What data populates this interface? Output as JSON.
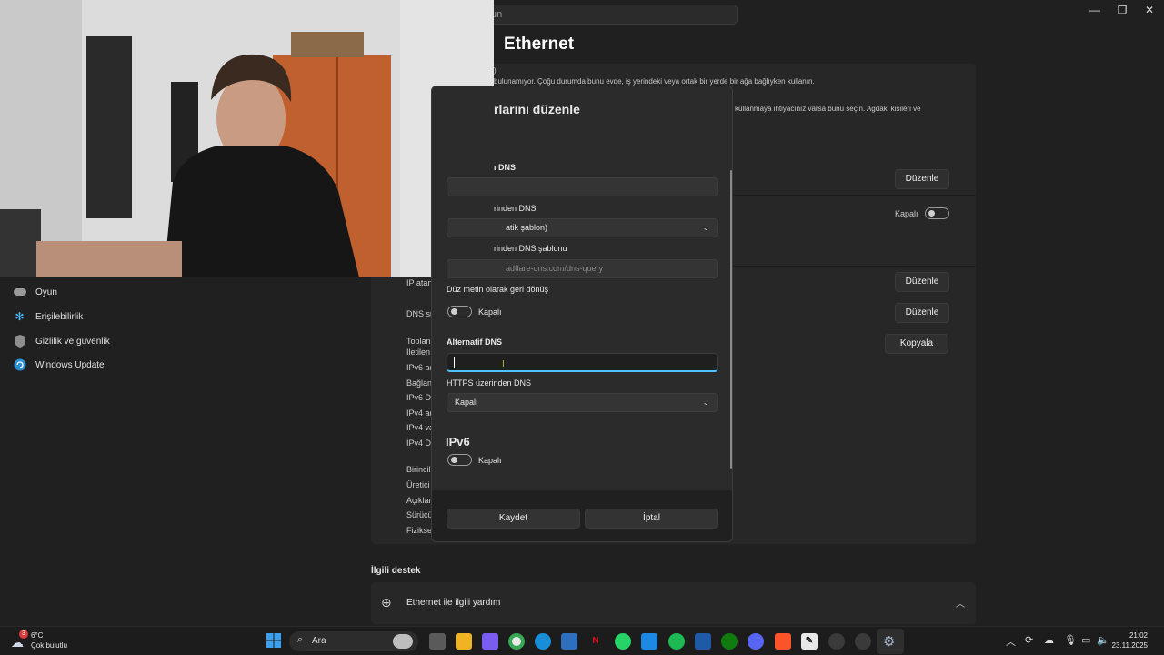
{
  "window": {
    "search_placeholder": "un",
    "page_title": "Ethernet",
    "controls": {
      "minimize": "—",
      "maximize": "❐",
      "close": "✕"
    }
  },
  "background": {
    "frag_1": ")",
    "frag_2": "bulunamıyor. Çoğu durumda bunu evde, iş yerindeki veya ortak bir yerde bir ağa bağlıyken kullanın.",
    "frag_3": "kullanmaya ihtiyacınız varsa bunu seçin. Ağdaki kişileri ve",
    "edit_button": "Düzenle",
    "toggle_label": "Kapalı",
    "copy_button": "Kopyala",
    "labels": [
      "IP atan",
      "DNS su",
      "Toplan",
      "İletilen",
      "IPv6 ad",
      "Bağlan",
      "IPv6 Dl",
      "IPv4 ad",
      "IPv4 va",
      "IPv4 Dl",
      "Birincil",
      "Üretici",
      "Açıklan",
      "Sürücü",
      "Fiziksel"
    ],
    "related_support": "İlgili destek",
    "help_item": "Ethernet ile ilgili yardım"
  },
  "sidebar": {
    "items": [
      {
        "label": "Oyun",
        "icon": "gamepad-icon"
      },
      {
        "label": "Erişilebilirlik",
        "icon": "accessibility-icon"
      },
      {
        "label": "Gizlilik ve güvenlik",
        "icon": "shield-icon"
      },
      {
        "label": "Windows Update",
        "icon": "update-icon"
      }
    ]
  },
  "dialog": {
    "title": "rlarını düzenle",
    "preferred_dns_label": "ı DNS",
    "preferred_dns_value": "",
    "doh_label_1": "rinden DNS",
    "doh_value_1": "atik şablon)",
    "doh_template_label": "rinden DNS şablonu",
    "doh_template_value": "adflare-dns.com/dns-query",
    "fallback_label": "Düz metin olarak geri dönüş",
    "fallback_toggle": "Kapalı",
    "alt_dns_label": "Alternatif DNS",
    "alt_dns_value": "",
    "alt_doh_label": "HTTPS üzerinden DNS",
    "alt_doh_value": "Kapalı",
    "ipv6_heading": "IPv6",
    "ipv6_toggle": "Kapalı",
    "save_button": "Kaydet",
    "cancel_button": "İptal"
  },
  "taskbar": {
    "weather_temp": "6°C",
    "weather_desc": "Çok bulutlu",
    "weather_badge": "3",
    "search_label": "Ara",
    "time": "21:02",
    "date": "23.11.2025"
  },
  "colors": {
    "accent": "#4cc2ff",
    "window_bg": "#202020",
    "panel_bg": "#272727",
    "dialog_bg": "#2b2b2b"
  }
}
